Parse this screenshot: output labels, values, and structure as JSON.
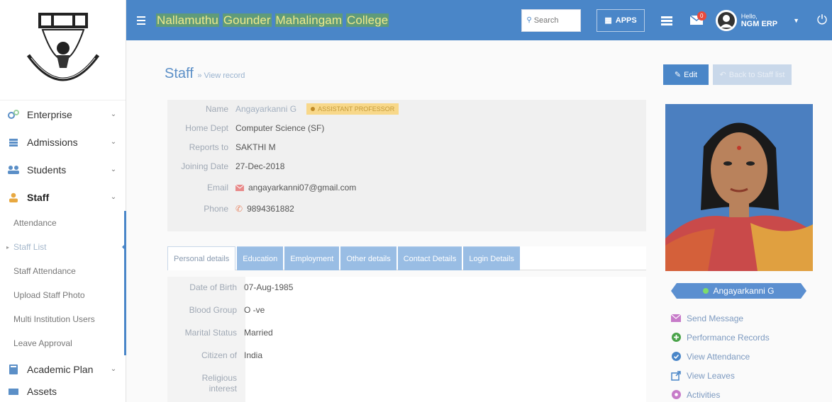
{
  "college": {
    "words": [
      "Nallamuthu",
      "Gounder",
      "Mahalingam",
      "College"
    ]
  },
  "topbar": {
    "search_placeholder": "Search",
    "apps_label": "APPS",
    "notification_count": "0",
    "user_greeting": "Hello,",
    "user_name": "NGM ERP"
  },
  "sidebar": {
    "items": [
      {
        "label": "Enterprise",
        "icon": "gears-icon"
      },
      {
        "label": "Admissions",
        "icon": "stack-icon"
      },
      {
        "label": "Students",
        "icon": "users-icon"
      },
      {
        "label": "Staff",
        "icon": "user-icon"
      }
    ],
    "staff_sub": [
      {
        "label": "Attendance"
      },
      {
        "label": "Staff List"
      },
      {
        "label": "Staff Attendance"
      },
      {
        "label": "Upload Staff Photo"
      },
      {
        "label": "Multi Institution Users"
      },
      {
        "label": "Leave Approval"
      }
    ],
    "after": [
      {
        "label": "Academic Plan",
        "icon": "book-icon"
      },
      {
        "label": "Assets",
        "icon": "box-icon"
      }
    ]
  },
  "page": {
    "title": "Staff",
    "subtitle": "» View record",
    "edit_label": "Edit",
    "back_label": "Back to Staff list"
  },
  "profile": {
    "name_label": "Name",
    "name": "Angayarkanni G",
    "role": "ASSISTANT PROFESSOR",
    "home_dept_label": "Home Dept",
    "home_dept": "Computer Science (SF)",
    "reports_to_label": "Reports to",
    "reports_to": "SAKTHI M",
    "joining_label": "Joining Date",
    "joining_date": "27-Dec-2018",
    "email_label": "Email",
    "email": "angayarkanni07@gmail.com",
    "phone_label": "Phone",
    "phone": "9894361882"
  },
  "tabs": [
    {
      "label": "Personal details",
      "active": true
    },
    {
      "label": "Education",
      "active": false
    },
    {
      "label": "Employment",
      "active": false
    },
    {
      "label": "Other details",
      "active": false
    },
    {
      "label": "Contact Details",
      "active": false
    },
    {
      "label": "Login Details",
      "active": false
    }
  ],
  "personal": {
    "dob_label": "Date of Birth",
    "dob": "07-Aug-1985",
    "blood_label": "Blood Group",
    "blood": "O -ve",
    "marital_label": "Marital Status",
    "marital": "Married",
    "citizen_label": "Citizen of",
    "citizen": "India",
    "religious_label_1": "Religious",
    "religious_label_2": "interest"
  },
  "side_panel": {
    "name_tag": "Angayarkanni G",
    "actions": [
      {
        "label": "Send Message",
        "icon": "envelope-icon",
        "color": "#c77bc9"
      },
      {
        "label": "Performance Records",
        "icon": "plus-circle-icon",
        "color": "#4aa34a"
      },
      {
        "label": "View Attendance",
        "icon": "check-circle-icon",
        "color": "#4a86c8"
      },
      {
        "label": "View Leaves",
        "icon": "external-link-icon",
        "color": "#4a86c8"
      },
      {
        "label": "Activities",
        "icon": "gear-circle-icon",
        "color": "#c77bc9"
      }
    ]
  },
  "colors": {
    "primary": "#4a86c8",
    "tab_inactive": "#99bde4",
    "role_badge": "#f8d88a"
  }
}
